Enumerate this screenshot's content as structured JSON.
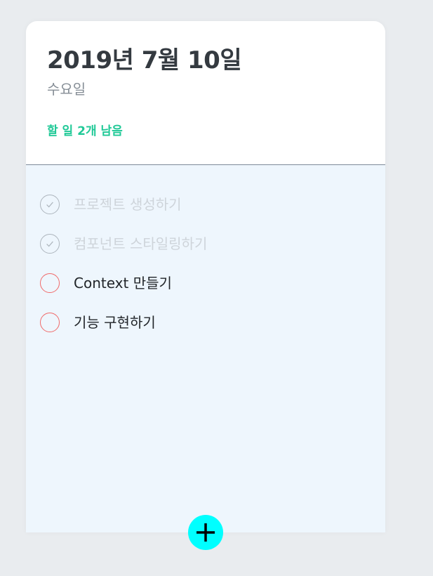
{
  "header": {
    "date": "2019년 7월 10일",
    "day": "수요일",
    "tasks_left": "할 일 2개 남음"
  },
  "todos": [
    {
      "text": "프로젝트 생성하기",
      "done": true
    },
    {
      "text": "컴포넌트 스타일링하기",
      "done": true
    },
    {
      "text": "Context 만들기",
      "done": false
    },
    {
      "text": "기능 구현하기",
      "done": false
    }
  ],
  "colors": {
    "background": "#e9ecef",
    "accent_green": "#20c997",
    "todo_circle": "#f06a6a",
    "done_text": "#ced4da",
    "add_button": "#00ffff"
  },
  "icons": {
    "done_check": "check-icon",
    "add": "plus-icon"
  }
}
